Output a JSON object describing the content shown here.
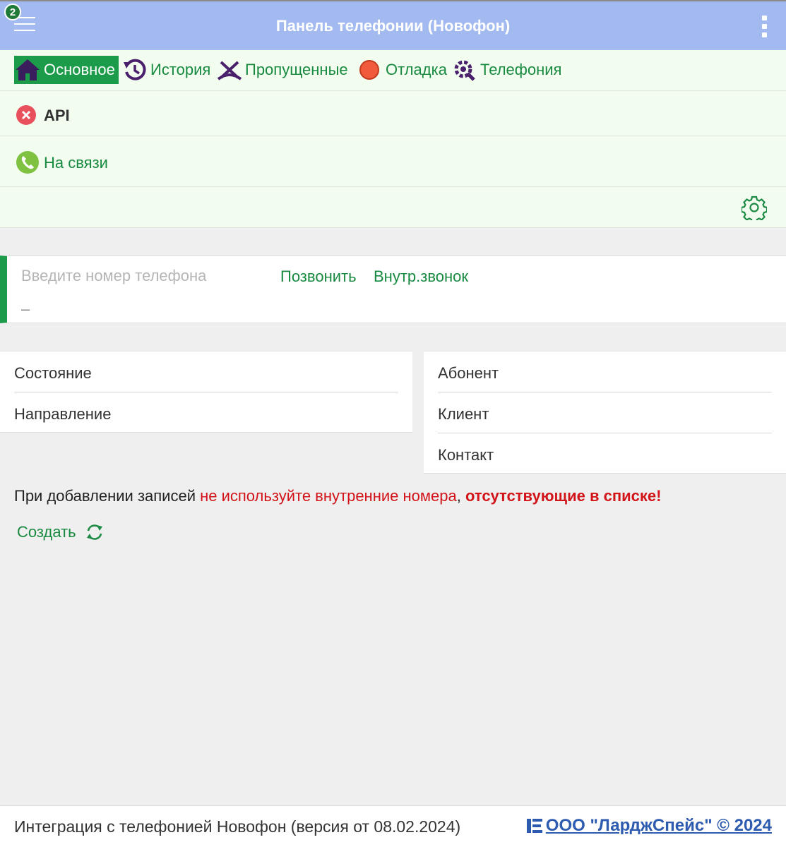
{
  "header": {
    "badge_count": "2",
    "title": "Панель телефонии (Новофон)"
  },
  "tabs": [
    {
      "label": "Основное",
      "icon": "home-icon",
      "active": true
    },
    {
      "label": "История",
      "icon": "history-icon",
      "active": false
    },
    {
      "label": "Пропущенные",
      "icon": "missed-call-icon",
      "active": false
    },
    {
      "label": "Отладка",
      "icon": "debug-dot-icon",
      "active": false
    },
    {
      "label": "Телефония",
      "icon": "telephony-settings-icon",
      "active": false
    }
  ],
  "status": {
    "api_label": "API",
    "api_icon": "error-x-icon",
    "connection_label": "На связи",
    "connection_icon": "phone-online-icon"
  },
  "dialer": {
    "placeholder": "Введите номер телефона",
    "value": "",
    "sub_value": "–",
    "call_label": "Позвонить",
    "internal_call_label": "Внутр.звонок"
  },
  "left_card": [
    "Состояние",
    "Направление"
  ],
  "right_card": [
    "Абонент",
    "Клиент",
    "Контакт"
  ],
  "note": {
    "part1": "При добавлении записей ",
    "part2": "не используйте внутренние номера",
    "part3": ", ",
    "part4": "отсутствующие в списке!"
  },
  "create_label": "Создать",
  "footer": {
    "version_text": "Интеграция с телефонией Новофон (версия от 08.02.2024)",
    "copyright": "ООО \"ЛарджСпейс\" © 2024"
  },
  "colors": {
    "header": "#a3baf0",
    "accent_green": "#1c9c4a",
    "link_green": "#188a40",
    "warning_red": "#d2141a",
    "footer_link": "#2d5bb0"
  }
}
